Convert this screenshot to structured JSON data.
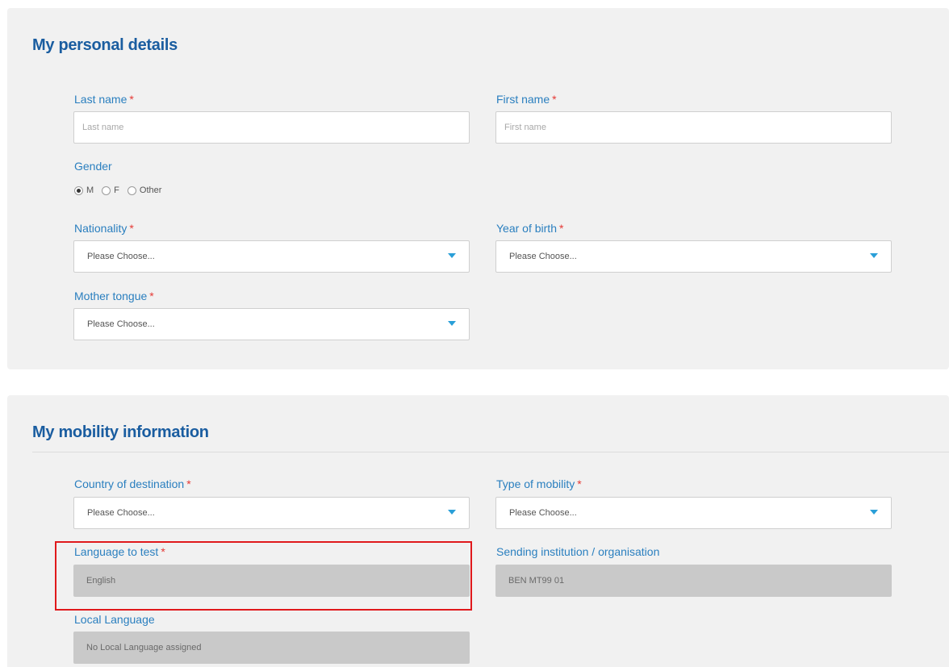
{
  "personal": {
    "title": "My personal details",
    "last_name": {
      "label": "Last name",
      "required": "*",
      "placeholder": "Last name",
      "value": ""
    },
    "first_name": {
      "label": "First name",
      "required": "*",
      "placeholder": "First name",
      "value": ""
    },
    "gender": {
      "label": "Gender",
      "options": [
        "M",
        "F",
        "Other"
      ],
      "selected": "M"
    },
    "nationality": {
      "label": "Nationality",
      "required": "*",
      "value": "Please Choose..."
    },
    "year_of_birth": {
      "label": "Year of birth",
      "required": "*",
      "value": "Please Choose..."
    },
    "mother_tongue": {
      "label": "Mother tongue",
      "required": "*",
      "value": "Please Choose..."
    }
  },
  "mobility": {
    "title": "My mobility information",
    "country": {
      "label": "Country of destination",
      "required": "*",
      "value": "Please Choose..."
    },
    "type": {
      "label": "Type of mobility",
      "required": "*",
      "value": "Please Choose..."
    },
    "language": {
      "label": "Language to test",
      "required": "*",
      "value": "English"
    },
    "sending": {
      "label": "Sending institution / organisation",
      "value": "BEN MT99 01"
    },
    "local_language": {
      "label": "Local Language",
      "value": "No Local Language assigned"
    }
  },
  "colors": {
    "title": "#1a5da0",
    "label": "#2a7fbf",
    "required": "#e53935",
    "caret": "#2a9fd8",
    "highlight": "#e0191c"
  },
  "icons": {
    "select_caret": "chevron-down-icon"
  }
}
